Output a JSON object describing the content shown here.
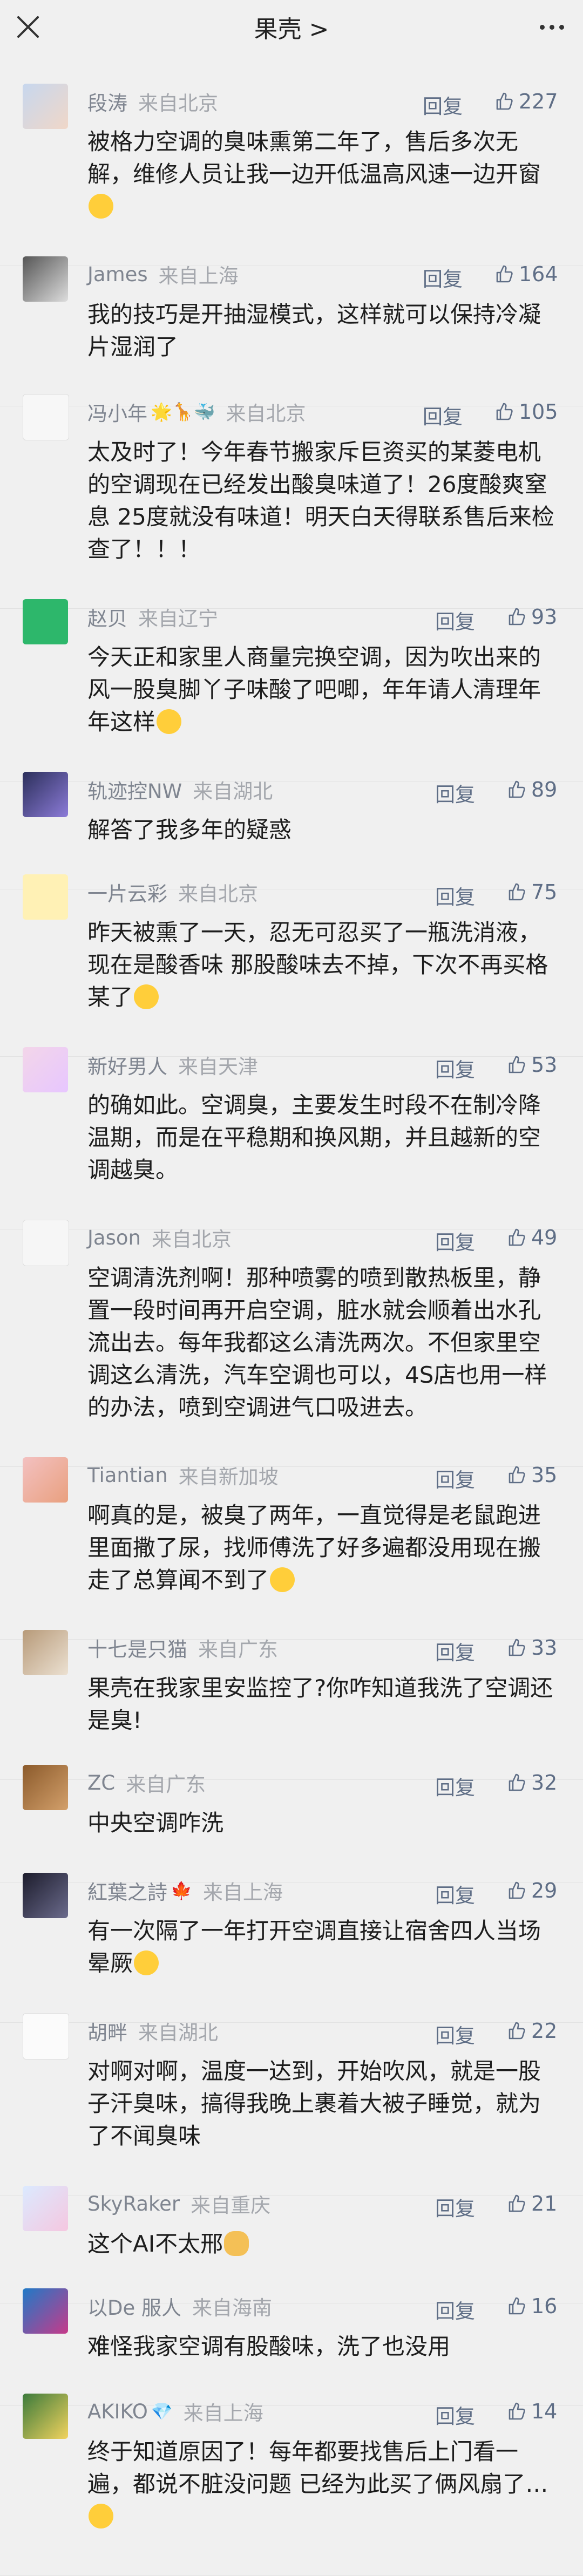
{
  "header": {
    "title": "果壳 >"
  },
  "labels": {
    "reply": "回复"
  },
  "comments": [
    {
      "author": "段涛",
      "location": "来自北京",
      "likes": "227",
      "text": "被格力空调的臭味熏第二年了，售后多次无解，维修人员让我一边开低温高风速一边开窗",
      "avatar": "baby-photo",
      "emoji": "worried-face"
    },
    {
      "author": "James",
      "location": "来自上海",
      "likes": "164",
      "text": "我的技巧是开抽湿模式，这样就可以保持冷凝片湿润了",
      "avatar": "sketch-photo"
    },
    {
      "author": "冯小年",
      "location": "来自北京",
      "likes": "105",
      "text": "太及时了！今年春节搬家斥巨资买的某菱电机的空调现在已经发出酸臭味道了！26度酸爽窒息 25度就没有味道！明天白天得联系售后来检查了！！！",
      "avatar": "bird-drawing",
      "emblem": "🌟🦒🐳"
    },
    {
      "author": "赵贝",
      "location": "来自辽宁",
      "likes": "93",
      "text": "今天正和家里人商量完换空调，因为吹出来的风一股臭脚丫子味酸了吧唧，年年请人清理年年这样",
      "avatar": "panda",
      "emoji": "crying-face"
    },
    {
      "author": "轨迹控NW",
      "location": "来自湖北",
      "likes": "89",
      "text": "解答了我多年的疑惑",
      "avatar": "anime-boy"
    },
    {
      "author": "一片云彩",
      "location": "来自北京",
      "likes": "75",
      "text": "昨天被熏了一天，忍无可忍买了一瓶洗消液，现在是酸香味 那股酸味去不掉，下次不再买格某了",
      "avatar": "sticker-face",
      "emoji": "crying-face"
    },
    {
      "author": "新好男人",
      "location": "来自天津",
      "likes": "53",
      "text": "的确如此。空调臭，主要发生时段不在制冷降温期，而是在平稳期和换风期，并且越新的空调越臭。",
      "avatar": "pink-sketch"
    },
    {
      "author": "Jason",
      "location": "来自北京",
      "likes": "49",
      "text": "空调清洗剂啊！那种喷雾的喷到散热板里，静置一段时间再开启空调，脏水就会顺着出水孔流出去。每年我都这么清洗两次。不但家里空调这么清洗，汽车空调也可以，4S店也用一样的办法，喷到空调进气口吸进去。",
      "avatar": "glasses-cartoon"
    },
    {
      "author": "Tiantian",
      "location": "来自新加坡",
      "likes": "35",
      "text": "啊真的是，被臭了两年，一直觉得是老鼠跑进里面撒了尿，找师傅洗了好多遍都没用现在搬走了总算闻不到了",
      "avatar": "girl-photo",
      "emoji": "sobbing-face"
    },
    {
      "author": "十七是只猫",
      "location": "来自广东",
      "likes": "33",
      "text": "果壳在我家里安监控了?你咋知道我洗了空调还是臭!",
      "avatar": "cat-photo"
    },
    {
      "author": "ZC",
      "location": "来自广东",
      "likes": "32",
      "text": "中央空调咋洗",
      "avatar": "room-photo"
    },
    {
      "author": "紅葉之詩",
      "location": "来自上海",
      "likes": "29",
      "text": "有一次隔了一年打开空调直接让宿舍四人当场晕厥",
      "avatar": "anime-dark",
      "emblem": "🍁",
      "emoji": "dizzy-face"
    },
    {
      "author": "胡畔",
      "location": "来自湖北",
      "likes": "22",
      "text": "对啊对啊，温度一达到，开始吹风，就是一股子汗臭味，搞得我晚上裹着大被子睡觉，就为了不闻臭味",
      "avatar": "white-sketch"
    },
    {
      "author": "SkyRaker",
      "location": "来自重庆",
      "likes": "21",
      "text": "这个AI不太邢",
      "avatar": "anime-girl",
      "emoji": "cat-face"
    },
    {
      "author": "以De 服人",
      "location": "来自海南",
      "likes": "16",
      "text": "难怪我家空调有股酸味，洗了也没用",
      "avatar": "colorful-photo"
    },
    {
      "author": "AKIKO",
      "location": "来自上海",
      "likes": "14",
      "text": "终于知道原因了！每年都要找售后上门看一遍，都说不脏没问题 已经为此买了俩风扇了…",
      "avatar": "flower-photo",
      "emblem": "💎",
      "emoji": "crying-face"
    }
  ],
  "colors": {
    "background": "#f0f0f0",
    "meta": "#7f8590",
    "action": "#5f6e86"
  }
}
